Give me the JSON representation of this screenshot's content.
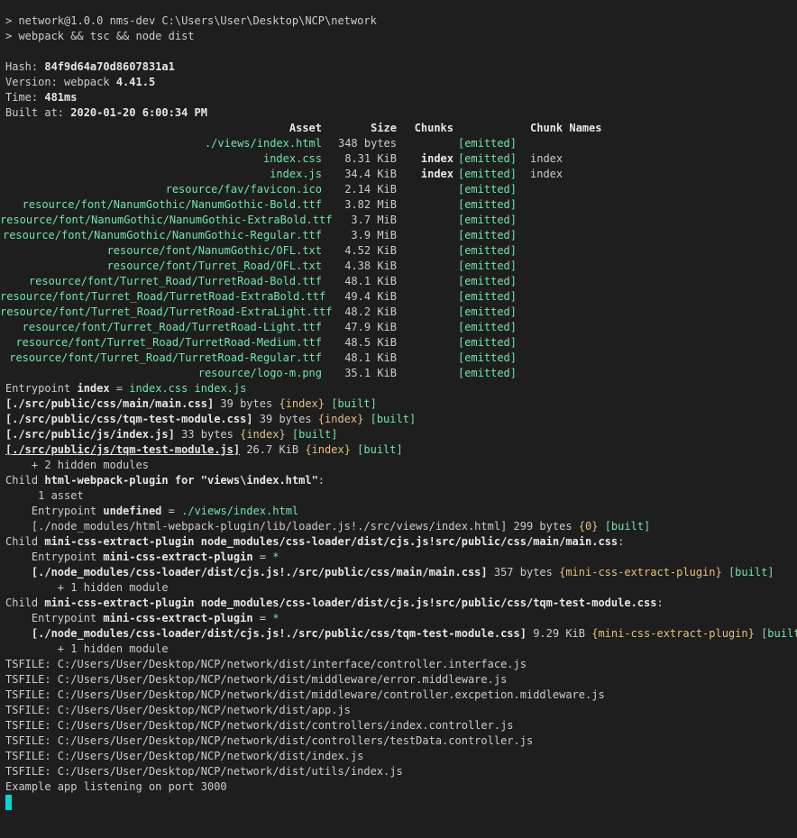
{
  "cmd": {
    "l1": "> network@1.0.0 nms-dev C:\\Users\\User\\Desktop\\NCP\\network",
    "l2": "> webpack && tsc && node dist"
  },
  "build": {
    "hash_label": "Hash: ",
    "hash": "84f9d64a70d8607831a1",
    "version_label": "Version: webpack ",
    "version": "4.41.5",
    "time_label": "Time: ",
    "time": "481ms",
    "built_label": "Built at: ",
    "built": "2020-01-20 6:00:34 PM"
  },
  "assets_table": {
    "headers": [
      "Asset",
      "Size",
      "Chunks",
      "",
      "Chunk Names"
    ],
    "rows": [
      {
        "asset": "./views/index.html",
        "size": "348 bytes",
        "chunks": "",
        "status": "[emitted]",
        "names": ""
      },
      {
        "asset": "index.css",
        "size": "8.31 KiB",
        "chunks": "index",
        "status": "[emitted]",
        "names": "index"
      },
      {
        "asset": "index.js",
        "size": "34.4 KiB",
        "chunks": "index",
        "status": "[emitted]",
        "names": "index"
      },
      {
        "asset": "resource/fav/favicon.ico",
        "size": "2.14 KiB",
        "chunks": "",
        "status": "[emitted]",
        "names": ""
      },
      {
        "asset": "resource/font/NanumGothic/NanumGothic-Bold.ttf",
        "size": "3.82 MiB",
        "chunks": "",
        "status": "[emitted]",
        "names": ""
      },
      {
        "asset": "resource/font/NanumGothic/NanumGothic-ExtraBold.ttf",
        "size": "3.7 MiB",
        "chunks": "",
        "status": "[emitted]",
        "names": ""
      },
      {
        "asset": "resource/font/NanumGothic/NanumGothic-Regular.ttf",
        "size": "3.9 MiB",
        "chunks": "",
        "status": "[emitted]",
        "names": ""
      },
      {
        "asset": "resource/font/NanumGothic/OFL.txt",
        "size": "4.52 KiB",
        "chunks": "",
        "status": "[emitted]",
        "names": ""
      },
      {
        "asset": "resource/font/Turret_Road/OFL.txt",
        "size": "4.38 KiB",
        "chunks": "",
        "status": "[emitted]",
        "names": ""
      },
      {
        "asset": "resource/font/Turret_Road/TurretRoad-Bold.ttf",
        "size": "48.1 KiB",
        "chunks": "",
        "status": "[emitted]",
        "names": ""
      },
      {
        "asset": "resource/font/Turret_Road/TurretRoad-ExtraBold.ttf",
        "size": "49.4 KiB",
        "chunks": "",
        "status": "[emitted]",
        "names": ""
      },
      {
        "asset": "resource/font/Turret_Road/TurretRoad-ExtraLight.ttf",
        "size": "48.2 KiB",
        "chunks": "",
        "status": "[emitted]",
        "names": ""
      },
      {
        "asset": "resource/font/Turret_Road/TurretRoad-Light.ttf",
        "size": "47.9 KiB",
        "chunks": "",
        "status": "[emitted]",
        "names": ""
      },
      {
        "asset": "resource/font/Turret_Road/TurretRoad-Medium.ttf",
        "size": "48.5 KiB",
        "chunks": "",
        "status": "[emitted]",
        "names": ""
      },
      {
        "asset": "resource/font/Turret_Road/TurretRoad-Regular.ttf",
        "size": "48.1 KiB",
        "chunks": "",
        "status": "[emitted]",
        "names": ""
      },
      {
        "asset": "resource/logo-m.png",
        "size": "35.1 KiB",
        "chunks": "",
        "status": "[emitted]",
        "names": ""
      }
    ]
  },
  "entry": {
    "label": "Entrypoint ",
    "name": "index",
    "eq": " = ",
    "files": "index.css index.js"
  },
  "modules": [
    {
      "path": "[./src/public/css/main/main.css]",
      "size": " 39 bytes ",
      "chunk": "{index}",
      "tag": "[built]"
    },
    {
      "path": "[./src/public/css/tqm-test-module.css]",
      "size": " 39 bytes ",
      "chunk": "{index}",
      "tag": "[built]"
    },
    {
      "path": "[./src/public/js/index.js]",
      "size": " 33 bytes ",
      "chunk": "{index}",
      "tag": "[built]"
    },
    {
      "path": "[./src/public/js/tqm-test-module.js]",
      "size": " 26.7 KiB ",
      "chunk": "{index}",
      "tag": "[built]"
    }
  ],
  "hidden2": "    + 2 hidden modules",
  "child1": {
    "prefix": "Child ",
    "name": "html-webpack-plugin for \"views\\index.html\"",
    "suffix": ":",
    "asset": "     1 asset",
    "ep_label": "    Entrypoint ",
    "ep_name": "undefined",
    "ep_eq": " = ",
    "ep_file": "./views/index.html",
    "mod_path": "    [./node_modules/html-webpack-plugin/lib/loader.js!./src/views/index.html]",
    "mod_size": " 299 bytes ",
    "mod_chunk": "{0}",
    "mod_tag": " [built]"
  },
  "child2": {
    "prefix": "Child ",
    "name": "mini-css-extract-plugin node_modules/css-loader/dist/cjs.js!src/public/css/main/main.css",
    "suffix": ":",
    "ep_label": "    Entrypoint ",
    "ep_name": "mini-css-extract-plugin",
    "ep_eq": " = ",
    "ep_star": "*",
    "mod_path": "    [./node_modules/css-loader/dist/cjs.js!./src/public/css/main/main.css]",
    "mod_size": " 357 bytes ",
    "mod_chunk": "{mini-css-extract-plugin}",
    "mod_tag": " [built]",
    "hidden": "        + 1 hidden module"
  },
  "child3": {
    "prefix": "Child ",
    "name": "mini-css-extract-plugin node_modules/css-loader/dist/cjs.js!src/public/css/tqm-test-module.css",
    "suffix": ":",
    "ep_label": "    Entrypoint ",
    "ep_name": "mini-css-extract-plugin",
    "ep_eq": " = ",
    "ep_star": "*",
    "mod_path": "    [./node_modules/css-loader/dist/cjs.js!./src/public/css/tqm-test-module.css]",
    "mod_size": " 9.29 KiB ",
    "mod_chunk": "{mini-css-extract-plugin}",
    "mod_tag": " [built]",
    "hidden": "        + 1 hidden module"
  },
  "tsfiles": [
    "TSFILE: C:/Users/User/Desktop/NCP/network/dist/interface/controller.interface.js",
    "TSFILE: C:/Users/User/Desktop/NCP/network/dist/middleware/error.middleware.js",
    "TSFILE: C:/Users/User/Desktop/NCP/network/dist/middleware/controller.excpetion.middleware.js",
    "TSFILE: C:/Users/User/Desktop/NCP/network/dist/app.js",
    "TSFILE: C:/Users/User/Desktop/NCP/network/dist/controllers/index.controller.js",
    "TSFILE: C:/Users/User/Desktop/NCP/network/dist/controllers/testData.controller.js",
    "TSFILE: C:/Users/User/Desktop/NCP/network/dist/index.js",
    "TSFILE: C:/Users/User/Desktop/NCP/network/dist/utils/index.js"
  ],
  "listening": "Example app listening on port 3000",
  "colors": {
    "background": "#1e1e1e",
    "text": "#cccccc",
    "green": "#6ee7a8",
    "cyan": "#4ec9b0",
    "yellow": "#e5c07b",
    "cursor": "#00d7d7"
  }
}
